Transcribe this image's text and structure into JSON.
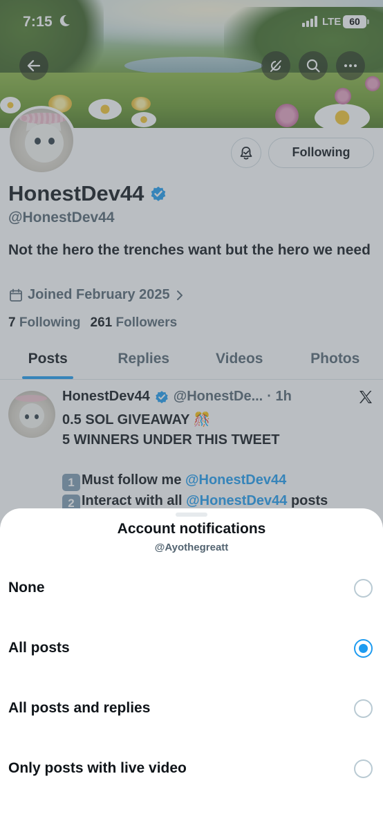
{
  "status_bar": {
    "time": "7:15",
    "network": "LTE",
    "battery": "60"
  },
  "profile": {
    "display_name": "HonestDev44",
    "handle": "@HonestDev44",
    "bio": "Not the hero the trenches want but the hero we need",
    "joined": "Joined February 2025",
    "following_count": "7",
    "following_label": "Following",
    "followers_count": "261",
    "followers_label": "Followers",
    "follow_button_label": "Following"
  },
  "tabs": [
    {
      "label": "Posts",
      "active": true
    },
    {
      "label": "Replies",
      "active": false
    },
    {
      "label": "Videos",
      "active": false
    },
    {
      "label": "Photos",
      "active": false
    }
  ],
  "tweet": {
    "author": "HonestDev44",
    "handle": "@HonestDe...",
    "time": "· 1h",
    "line1": "0.5 SOL GIVEAWAY 🎊",
    "line2": "5 WINNERS UNDER THIS TWEET",
    "item1_key": "1",
    "item1_text": "Must follow me ",
    "item1_mention": "@HonestDev44",
    "item2_key": "2",
    "item2_text": "Interact with all ",
    "item2_mention": "@HonestDev44",
    "item2_suffix": " posts"
  },
  "sheet": {
    "title": "Account notifications",
    "subtitle": "@Ayothegreatt",
    "options": [
      {
        "label": "None",
        "selected": false
      },
      {
        "label": "All posts",
        "selected": true
      },
      {
        "label": "All posts and replies",
        "selected": false
      },
      {
        "label": "Only posts with live video",
        "selected": false
      }
    ]
  },
  "colors": {
    "accent": "#1d9bf0",
    "text": "#0f1419",
    "secondary": "#536471"
  },
  "icons": [
    "back-arrow-icon",
    "mute-icon",
    "search-icon",
    "more-icon",
    "bell-icon",
    "verified-badge-icon",
    "calendar-icon",
    "chevron-right-icon",
    "x-logo-icon",
    "moon-icon",
    "signal-icon"
  ]
}
